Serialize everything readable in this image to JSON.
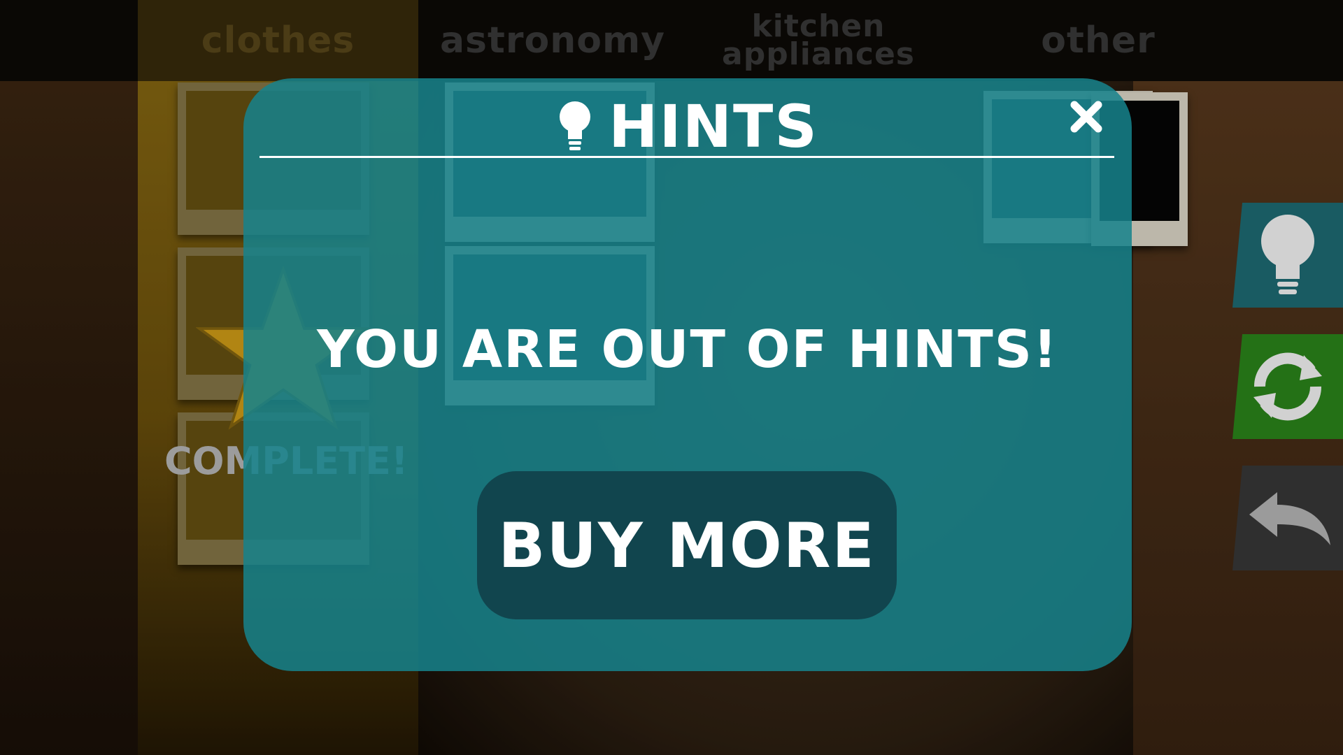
{
  "categories": [
    {
      "label": "clothes",
      "state": "selected"
    },
    {
      "label": "astronomy",
      "state": "normal"
    },
    {
      "label": "kitchen\nappliances",
      "state": "normal"
    },
    {
      "label": "other",
      "state": "normal"
    }
  ],
  "board": {
    "completion_label": "COMPLETE!",
    "star_color": "#d8a318"
  },
  "side_buttons": {
    "hint_icon": "lightbulb-icon",
    "refresh_icon": "refresh-icon",
    "back_icon": "back-arrow-icon"
  },
  "modal": {
    "title": "HINTS",
    "title_icon": "lightbulb-icon",
    "close_icon": "close-icon",
    "message": "YOU ARE OUT OF HINTS!",
    "action_label": "BUY MORE",
    "panel_color": "#16828c",
    "button_color": "#11454e"
  }
}
